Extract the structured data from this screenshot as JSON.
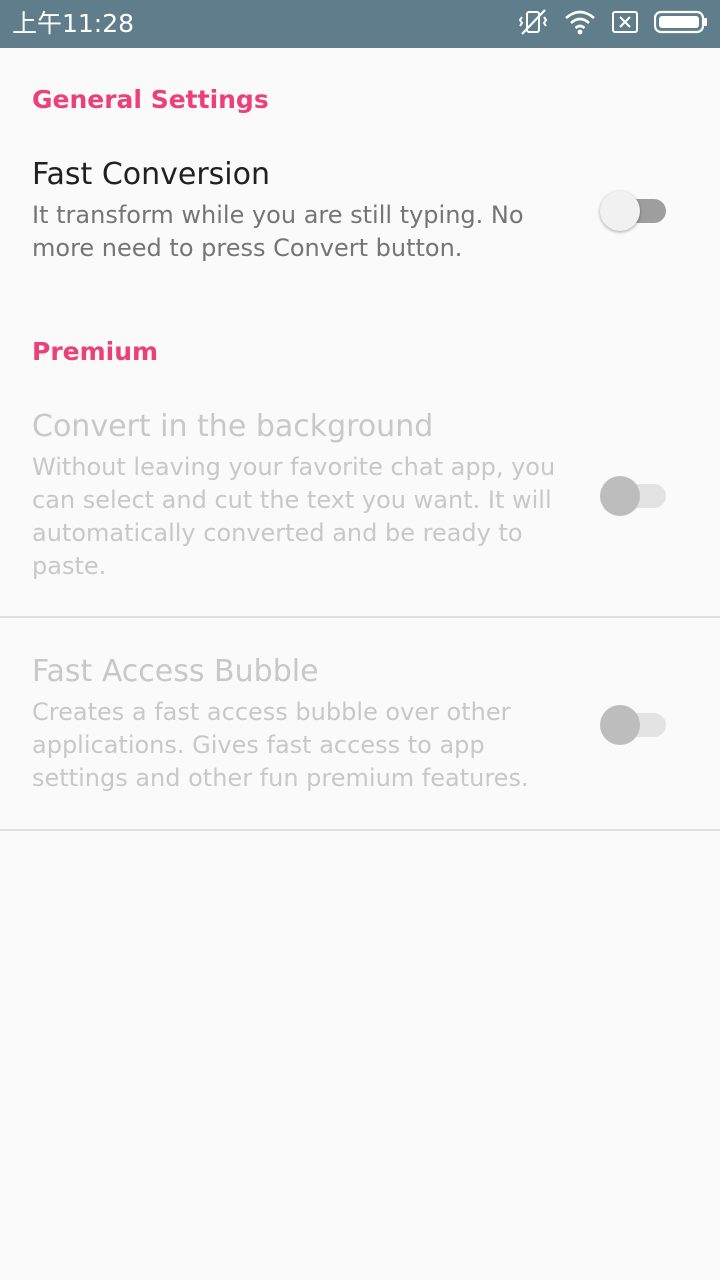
{
  "status_bar": {
    "time": "上午11:28",
    "icons": [
      "vibrate-off-icon",
      "wifi-icon",
      "sim-none-icon",
      "battery-icon"
    ],
    "background": "#607d8b"
  },
  "accent_color": "#ec407a",
  "sections": {
    "general": {
      "header": "General Settings",
      "fast_conversion": {
        "title": "Fast Conversion",
        "summary": "It transform while you are still typing. No more need to press Convert button.",
        "checked": false,
        "enabled": true
      }
    },
    "premium": {
      "header": "Premium",
      "convert_background": {
        "title": "Convert in the background",
        "summary": "Without leaving your favorite chat app, you can select and cut the text you want. It will automatically converted and be ready to paste.",
        "checked": false,
        "enabled": false
      },
      "fast_access_bubble": {
        "title": "Fast Access Bubble",
        "summary": "Creates a fast access bubble over other applications. Gives fast access to app settings and other fun premium features.",
        "checked": false,
        "enabled": false
      }
    }
  }
}
